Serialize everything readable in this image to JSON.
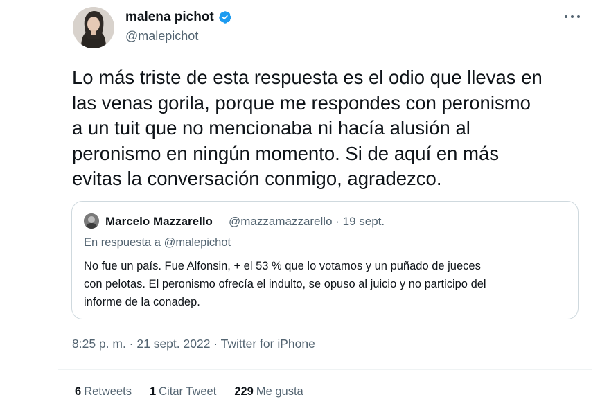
{
  "author": {
    "name": "malena pichot",
    "handle": "@malepichot",
    "verified": true
  },
  "tweet": {
    "text": "Lo más triste de esta respuesta es el odio que llevas en\nlas venas gorila, porque me respondes con peronismo\na un tuit que no mencionaba ni hacía alusión al\nperonismo en ningún momento. Si de aquí en más\nevitas la conversación conmigo, agradezco."
  },
  "quoted_tweet": {
    "name": "Marcelo Mazzarello",
    "handle_and_date": "@mazzamazzarello · 19 sept.",
    "reply_to": "En respuesta a @malepichot",
    "text": "No fue un país. Fue Alfonsin, + el 53 % que lo votamos  y un puñado de jueces\ncon pelotas. El peronismo ofrecía el indulto, se opuso al juicio  y no participo del\ninforme de la conadep."
  },
  "meta": {
    "timestamp": "8:25 p. m. · 21 sept. 2022 · Twitter for iPhone"
  },
  "stats": {
    "retweets_count": "6",
    "retweets_label": "Retweets",
    "quotes_count": "1",
    "quotes_label": "Citar Tweet",
    "likes_count": "229",
    "likes_label": "Me gusta"
  },
  "colors": {
    "verified": "#1d9bf0",
    "secondary_text": "#536471",
    "primary_text": "#0f1419",
    "border": "#cfd9de"
  },
  "icons": [
    "verified-badge-icon",
    "more-options-icon"
  ]
}
